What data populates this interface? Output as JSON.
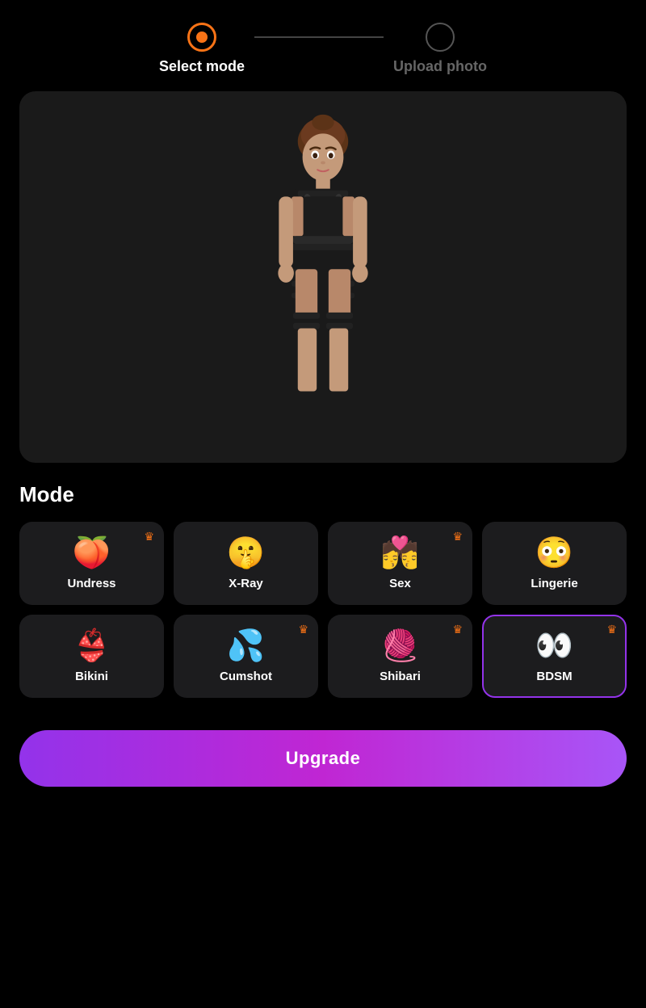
{
  "nav": {
    "step1": {
      "label": "Select mode",
      "state": "active"
    },
    "step2": {
      "label": "Upload photo",
      "state": "inactive"
    }
  },
  "mode_section": {
    "title": "Mode"
  },
  "modes": [
    {
      "id": "undress",
      "emoji": "🍑",
      "label": "Undress",
      "crown": true,
      "selected": false
    },
    {
      "id": "xray",
      "emoji": "🤫",
      "label": "X-Ray",
      "crown": false,
      "selected": false
    },
    {
      "id": "sex",
      "emoji": "💏",
      "label": "Sex",
      "crown": true,
      "selected": false
    },
    {
      "id": "lingerie",
      "emoji": "😳",
      "label": "Lingerie",
      "crown": false,
      "selected": false
    },
    {
      "id": "bikini",
      "emoji": "👙",
      "label": "Bikini",
      "crown": false,
      "selected": false
    },
    {
      "id": "cumshot",
      "emoji": "💦",
      "label": "Cumshot",
      "crown": true,
      "selected": false
    },
    {
      "id": "shibari",
      "emoji": "🧶",
      "label": "Shibari",
      "crown": true,
      "selected": false
    },
    {
      "id": "bdsm",
      "emoji": "👀",
      "label": "BDSM",
      "crown": true,
      "selected": true
    }
  ],
  "upgrade": {
    "label": "Upgrade"
  },
  "crown_symbol": "♛"
}
